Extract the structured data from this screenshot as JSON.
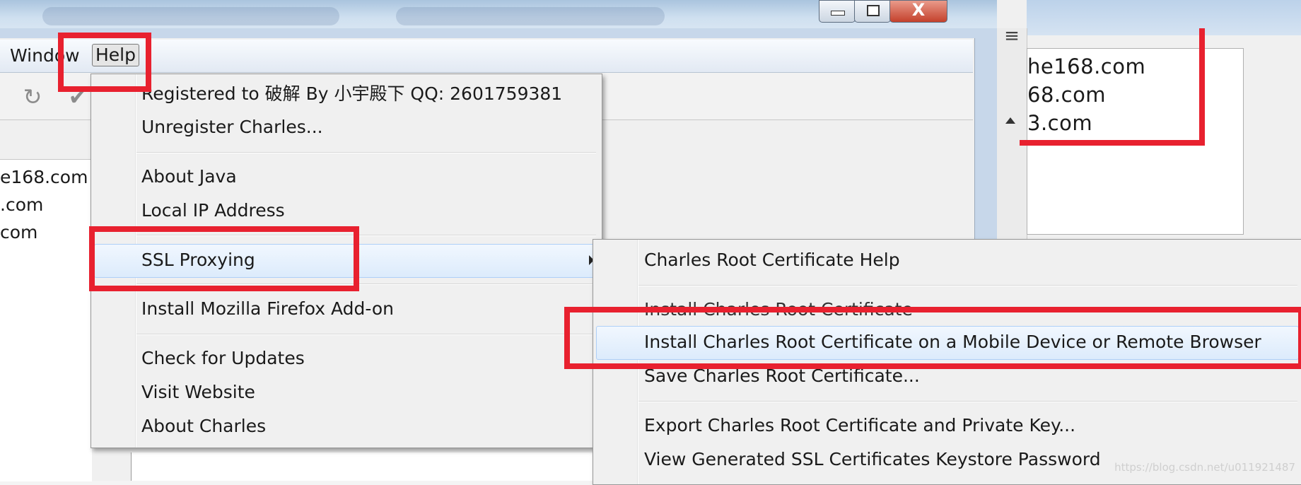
{
  "menubar": {
    "window_label": "Window",
    "help_label": "Help"
  },
  "left_hosts": [
    "e168.com",
    ".com",
    "com"
  ],
  "right_hosts": [
    "he168.com",
    "68.com",
    "3.com"
  ],
  "help_menu": {
    "registered": "Registered to 破解 By 小宇殿下 QQ: 2601759381",
    "unregister": "Unregister Charles...",
    "about_java": "About Java",
    "local_ip": "Local IP Address",
    "ssl_proxying": "SSL Proxying",
    "install_firefox": "Install Mozilla Firefox Add-on",
    "check_updates": "Check for Updates",
    "visit_website": "Visit Website",
    "about_charles": "About Charles"
  },
  "ssl_submenu": {
    "root_cert_help": "Charles Root Certificate Help",
    "install_root_cert": "Install Charles Root Certificate",
    "install_mobile": "Install Charles Root Certificate on a Mobile Device or Remote Browser",
    "save_root_cert": "Save Charles Root Certificate...",
    "export_key": "Export Charles Root Certificate and Private Key...",
    "view_keystore": "View Generated SSL Certificates Keystore Password"
  },
  "window_buttons": {
    "close_glyph": "X"
  },
  "toolbar": {
    "refresh_glyph": "↻",
    "check_glyph": "✔"
  },
  "watermark": "https://blog.csdn.net/u011921487",
  "colors": {
    "annotation_red": "#e8212f",
    "highlight_bg": "#dcebfc",
    "menu_bg": "#f0f0f0"
  }
}
